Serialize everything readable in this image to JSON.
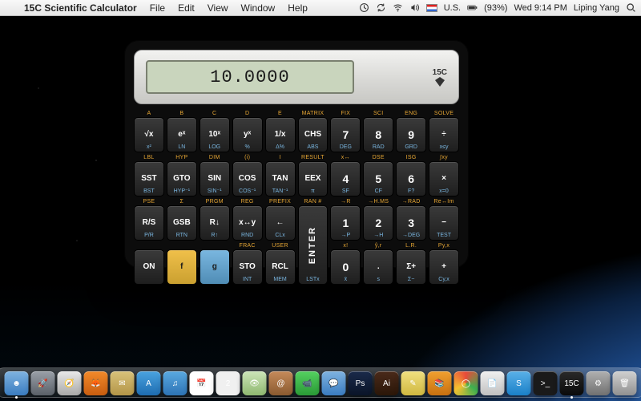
{
  "menubar": {
    "app_name": "15C Scientific Calculator",
    "items": [
      "File",
      "Edit",
      "View",
      "Window",
      "Help"
    ],
    "status": {
      "input_label": "U.S.",
      "battery": "(93%)",
      "clock": "Wed 9:14 PM",
      "user": "Liping Yang"
    }
  },
  "calculator": {
    "logo_label": "15C",
    "display_value": "10.0000",
    "rows": [
      [
        {
          "top": "A",
          "mid": "√x",
          "bot": "x²"
        },
        {
          "top": "B",
          "mid": "eˣ",
          "bot": "LN"
        },
        {
          "top": "C",
          "mid": "10ˣ",
          "bot": "LOG"
        },
        {
          "top": "D",
          "mid": "yˣ",
          "bot": "%"
        },
        {
          "top": "E",
          "mid": "1/x",
          "bot": "Δ%"
        },
        {
          "top": "MATRIX",
          "mid": "CHS",
          "bot": "ABS"
        },
        {
          "top": "FIX",
          "mid": "7",
          "bot": "DEG",
          "num": true
        },
        {
          "top": "SCI",
          "mid": "8",
          "bot": "RAD",
          "num": true
        },
        {
          "top": "ENG",
          "mid": "9",
          "bot": "GRD",
          "num": true
        },
        {
          "top": "SOLVE",
          "mid": "÷",
          "bot": "x≤y"
        }
      ],
      [
        {
          "top": "LBL",
          "mid": "SST",
          "bot": "BST"
        },
        {
          "top": "HYP",
          "mid": "GTO",
          "bot": "HYP⁻¹"
        },
        {
          "top": "DIM",
          "mid": "SIN",
          "bot": "SIN⁻¹"
        },
        {
          "top": "(i)",
          "mid": "COS",
          "bot": "COS⁻¹"
        },
        {
          "top": "I",
          "mid": "TAN",
          "bot": "TAN⁻¹"
        },
        {
          "top": "RESULT",
          "mid": "EEX",
          "bot": "π"
        },
        {
          "top": "x↔",
          "mid": "4",
          "bot": "SF",
          "num": true
        },
        {
          "top": "DSE",
          "mid": "5",
          "bot": "CF",
          "num": true
        },
        {
          "top": "ISG",
          "mid": "6",
          "bot": "F?",
          "num": true
        },
        {
          "top": "∫xy",
          "mid": "×",
          "bot": "x=0"
        }
      ],
      [
        {
          "top": "PSE",
          "mid": "R/S",
          "bot": "P/R"
        },
        {
          "top": "Σ",
          "mid": "GSB",
          "bot": "RTN"
        },
        {
          "top": "PRGM",
          "mid": "R↓",
          "bot": "R↑"
        },
        {
          "top": "REG",
          "mid": "x↔y",
          "bot": "RND"
        },
        {
          "top": "PREFIX",
          "mid": "←",
          "bot": "CLx"
        },
        {
          "top": "RAN #",
          "mid": "ENTER",
          "bot": "LSTx",
          "enter": true
        },
        {
          "top": "→R",
          "mid": "1",
          "bot": "→P",
          "num": true
        },
        {
          "top": "→H.MS",
          "mid": "2",
          "bot": "→H",
          "num": true
        },
        {
          "top": "→RAD",
          "mid": "3",
          "bot": "→DEG",
          "num": true
        },
        {
          "top": "Re↔Im",
          "mid": "−",
          "bot": "TEST"
        }
      ],
      [
        {
          "top": "",
          "mid": "ON",
          "bot": ""
        },
        {
          "top": "",
          "mid": "f",
          "bot": "",
          "f": true
        },
        {
          "top": "",
          "mid": "g",
          "bot": "",
          "g": true
        },
        {
          "top": "FRAC",
          "mid": "STO",
          "bot": "INT"
        },
        {
          "top": "USER",
          "mid": "RCL",
          "bot": "MEM"
        },
        {
          "skip": true
        },
        {
          "top": "x!",
          "mid": "0",
          "bot": "x̄",
          "num": true
        },
        {
          "top": "ŷ,r",
          "mid": ".",
          "bot": "s"
        },
        {
          "top": "L.R.",
          "mid": "Σ+",
          "bot": "Σ−"
        },
        {
          "top": "Py,x",
          "mid": "+",
          "bot": "Cy,x"
        }
      ]
    ]
  },
  "dock": {
    "apps": [
      {
        "name": "finder",
        "bg": "linear-gradient(#7fb3e0,#3a7cc0)",
        "glyph": "☻",
        "running": true
      },
      {
        "name": "launchpad",
        "bg": "linear-gradient(#9aa0a8,#5a6068)",
        "glyph": "🚀"
      },
      {
        "name": "safari",
        "bg": "linear-gradient(#e8e8e8,#a9a9a9)",
        "glyph": "🧭"
      },
      {
        "name": "firefox",
        "bg": "linear-gradient(#f28a2a,#c85d10)",
        "glyph": "🦊"
      },
      {
        "name": "mail",
        "bg": "linear-gradient(#d9c27a,#b39548)",
        "glyph": "✉︎"
      },
      {
        "name": "appstore",
        "bg": "linear-gradient(#4aa3e0,#1e6cb0)",
        "glyph": "A"
      },
      {
        "name": "itunes",
        "bg": "linear-gradient(#5aa9e0,#2d73b5)",
        "glyph": "♫"
      },
      {
        "name": "calendar",
        "bg": "#fff",
        "glyph": "📅"
      },
      {
        "name": "ical",
        "bg": "#f0f0f0",
        "glyph": "2"
      },
      {
        "name": "preview",
        "bg": "linear-gradient(#cce5b8,#8fb870)",
        "glyph": "👁"
      },
      {
        "name": "contacts",
        "bg": "linear-gradient(#c58a5a,#8a5a30)",
        "glyph": "@"
      },
      {
        "name": "facetime",
        "bg": "linear-gradient(#54d060,#2a9a36)",
        "glyph": "📹"
      },
      {
        "name": "messages",
        "bg": "linear-gradient(#7fb3e0,#3a7cc0)",
        "glyph": "💬"
      },
      {
        "name": "photoshop",
        "bg": "linear-gradient(#1a2a4a,#0a1428)",
        "glyph": "Ps"
      },
      {
        "name": "illustrator",
        "bg": "linear-gradient(#4a2a1a,#2a1608)",
        "glyph": "Ai"
      },
      {
        "name": "notes",
        "bg": "linear-gradient(#f0e080,#d0b840)",
        "glyph": "✎"
      },
      {
        "name": "books",
        "bg": "linear-gradient(#f0a030,#c87010)",
        "glyph": "📚"
      },
      {
        "name": "chrome",
        "bg": "conic-gradient(#e84a3a,#3cb050,#f5c030,#e84a3a)",
        "glyph": "◯"
      },
      {
        "name": "pages",
        "bg": "linear-gradient(#f0f0f0,#c0c0c0)",
        "glyph": "📄"
      },
      {
        "name": "skype",
        "bg": "linear-gradient(#5ab0e8,#1a80c8)",
        "glyph": "S"
      },
      {
        "name": "terminal",
        "bg": "#1a1a1a",
        "glyph": ">_"
      },
      {
        "name": "15c",
        "bg": "linear-gradient(#2a2a2a,#0a0a0a)",
        "glyph": "15C",
        "running": true
      },
      {
        "name": "sysprefs",
        "bg": "linear-gradient(#b0b0b0,#707070)",
        "glyph": "⚙︎"
      },
      {
        "name": "trash",
        "bg": "linear-gradient(#d0d0d0,#909090)",
        "glyph": "🗑"
      }
    ]
  }
}
